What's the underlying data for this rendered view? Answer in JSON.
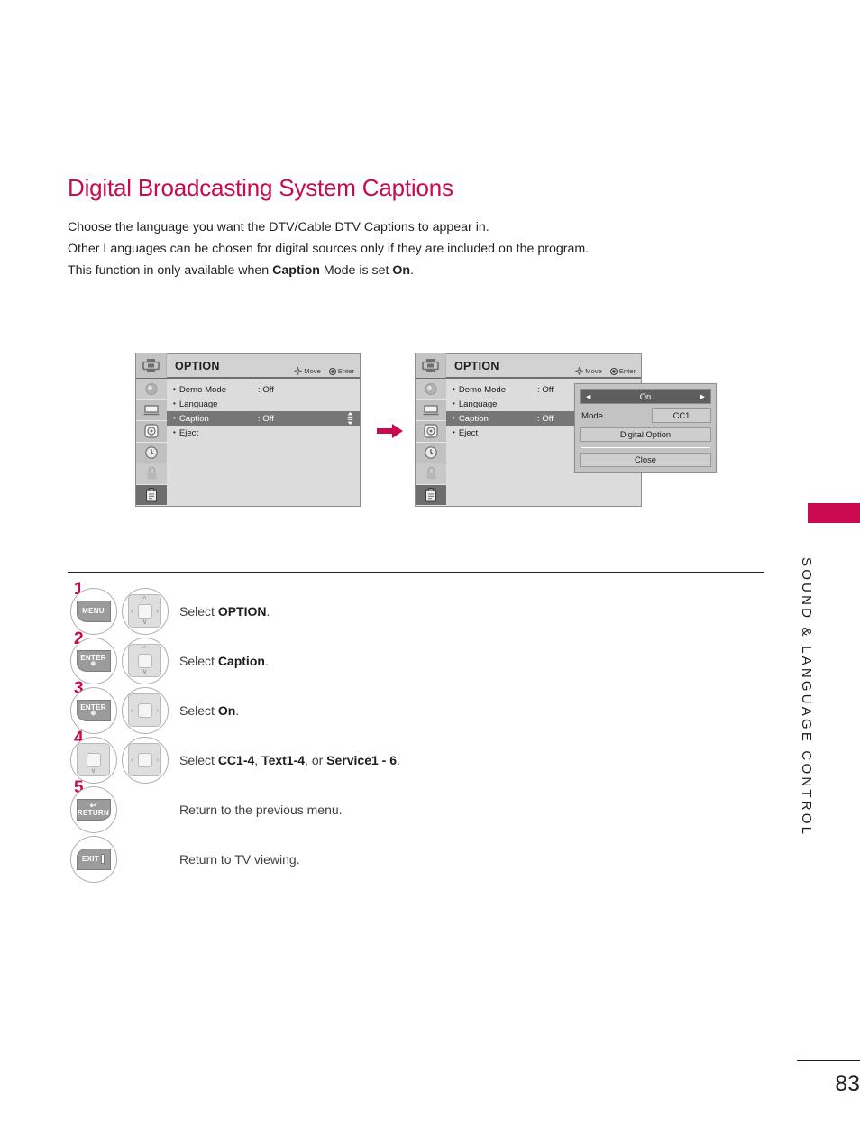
{
  "page": {
    "title": "Digital Broadcasting System Captions",
    "number": "83",
    "side_title": "SOUND & LANGUAGE CONTROL",
    "accent_color": "#c90a50",
    "intro_lines": [
      "Choose the language you want the DTV/Cable DTV Captions to appear in.",
      "Other Languages can be chosen for digital sources only if they are included on the program."
    ],
    "intro_line3": {
      "pre": "This function in only available when ",
      "bold1": "Caption",
      "mid": " Mode is set ",
      "bold2": "On",
      "post": "."
    }
  },
  "osd": {
    "header_title": "OPTION",
    "header_icon": "option-menu-icon",
    "hints": [
      {
        "icon": "move-dpad-icon",
        "label": "Move"
      },
      {
        "icon": "enter-dot-icon",
        "label": "Enter"
      }
    ],
    "rail_icons": [
      "audio-speaker-icon",
      "picture-tv-icon",
      "setup-target-icon",
      "time-clock-icon",
      "lock-padlock-icon",
      "option-clipboard-icon"
    ],
    "rows": [
      {
        "label": "Demo Mode",
        "value": ": Off",
        "selected": false
      },
      {
        "label": "Language",
        "value": "",
        "selected": false
      },
      {
        "label": "Caption",
        "value": ": Off",
        "selected": true
      },
      {
        "label": "Eject",
        "value": "",
        "selected": false
      }
    ],
    "scroll_indicator": "updown-arrows-icon"
  },
  "popup": {
    "toggle": {
      "left_arrow": "◀",
      "value": "On",
      "right_arrow": "▶"
    },
    "mode_label": "Mode",
    "mode_value": "CC1",
    "digital_option_label": "Digital Option",
    "close_label": "Close"
  },
  "flow_arrow": "right-arrow-icon",
  "steps": [
    {
      "number": "1",
      "keys": [
        {
          "type": "key",
          "name": "menu-button",
          "label": "MENU",
          "sub": ""
        },
        {
          "type": "pad",
          "name": "nav-pad-leftright-updown",
          "arrows": [
            "up",
            "down",
            "left",
            "right"
          ]
        }
      ],
      "text": {
        "pre": "Select ",
        "bold": "OPTION",
        "post": "."
      }
    },
    {
      "number": "2",
      "keys": [
        {
          "type": "key",
          "name": "enter-button",
          "label": "ENTER",
          "sub": "⊛"
        },
        {
          "type": "pad",
          "name": "nav-pad-updown",
          "arrows": [
            "up",
            "down"
          ]
        }
      ],
      "text": {
        "pre": "Select ",
        "bold": "Caption",
        "post": "."
      }
    },
    {
      "number": "3",
      "keys": [
        {
          "type": "key",
          "name": "enter-button",
          "label": "ENTER",
          "sub": "⊛"
        },
        {
          "type": "pad",
          "name": "nav-pad-leftright",
          "arrows": [
            "left",
            "right"
          ]
        }
      ],
      "text": {
        "pre": "Select ",
        "bold": "On",
        "post": "."
      }
    },
    {
      "number": "4",
      "keys": [
        {
          "type": "pad",
          "name": "nav-pad-down",
          "arrows": [
            "down"
          ]
        },
        {
          "type": "pad",
          "name": "nav-pad-leftright",
          "arrows": [
            "left",
            "right"
          ]
        }
      ],
      "text_rich": [
        {
          "t": "Select ",
          "b": false
        },
        {
          "t": "CC1-4",
          "b": true
        },
        {
          "t": ", ",
          "b": false
        },
        {
          "t": "Text1-4",
          "b": true
        },
        {
          "t": ", or ",
          "b": false
        },
        {
          "t": "Service1 - 6",
          "b": true
        },
        {
          "t": ".",
          "b": false
        }
      ]
    },
    {
      "number": "5",
      "keys": [
        {
          "type": "key",
          "name": "return-button",
          "label": "RETURN",
          "sub": ""
        }
      ],
      "plain_text": "Return to the previous menu."
    },
    {
      "number": "",
      "keys": [
        {
          "type": "key",
          "name": "exit-button",
          "label": "EXIT",
          "sub": ""
        }
      ],
      "plain_text": "Return to TV viewing."
    }
  ]
}
